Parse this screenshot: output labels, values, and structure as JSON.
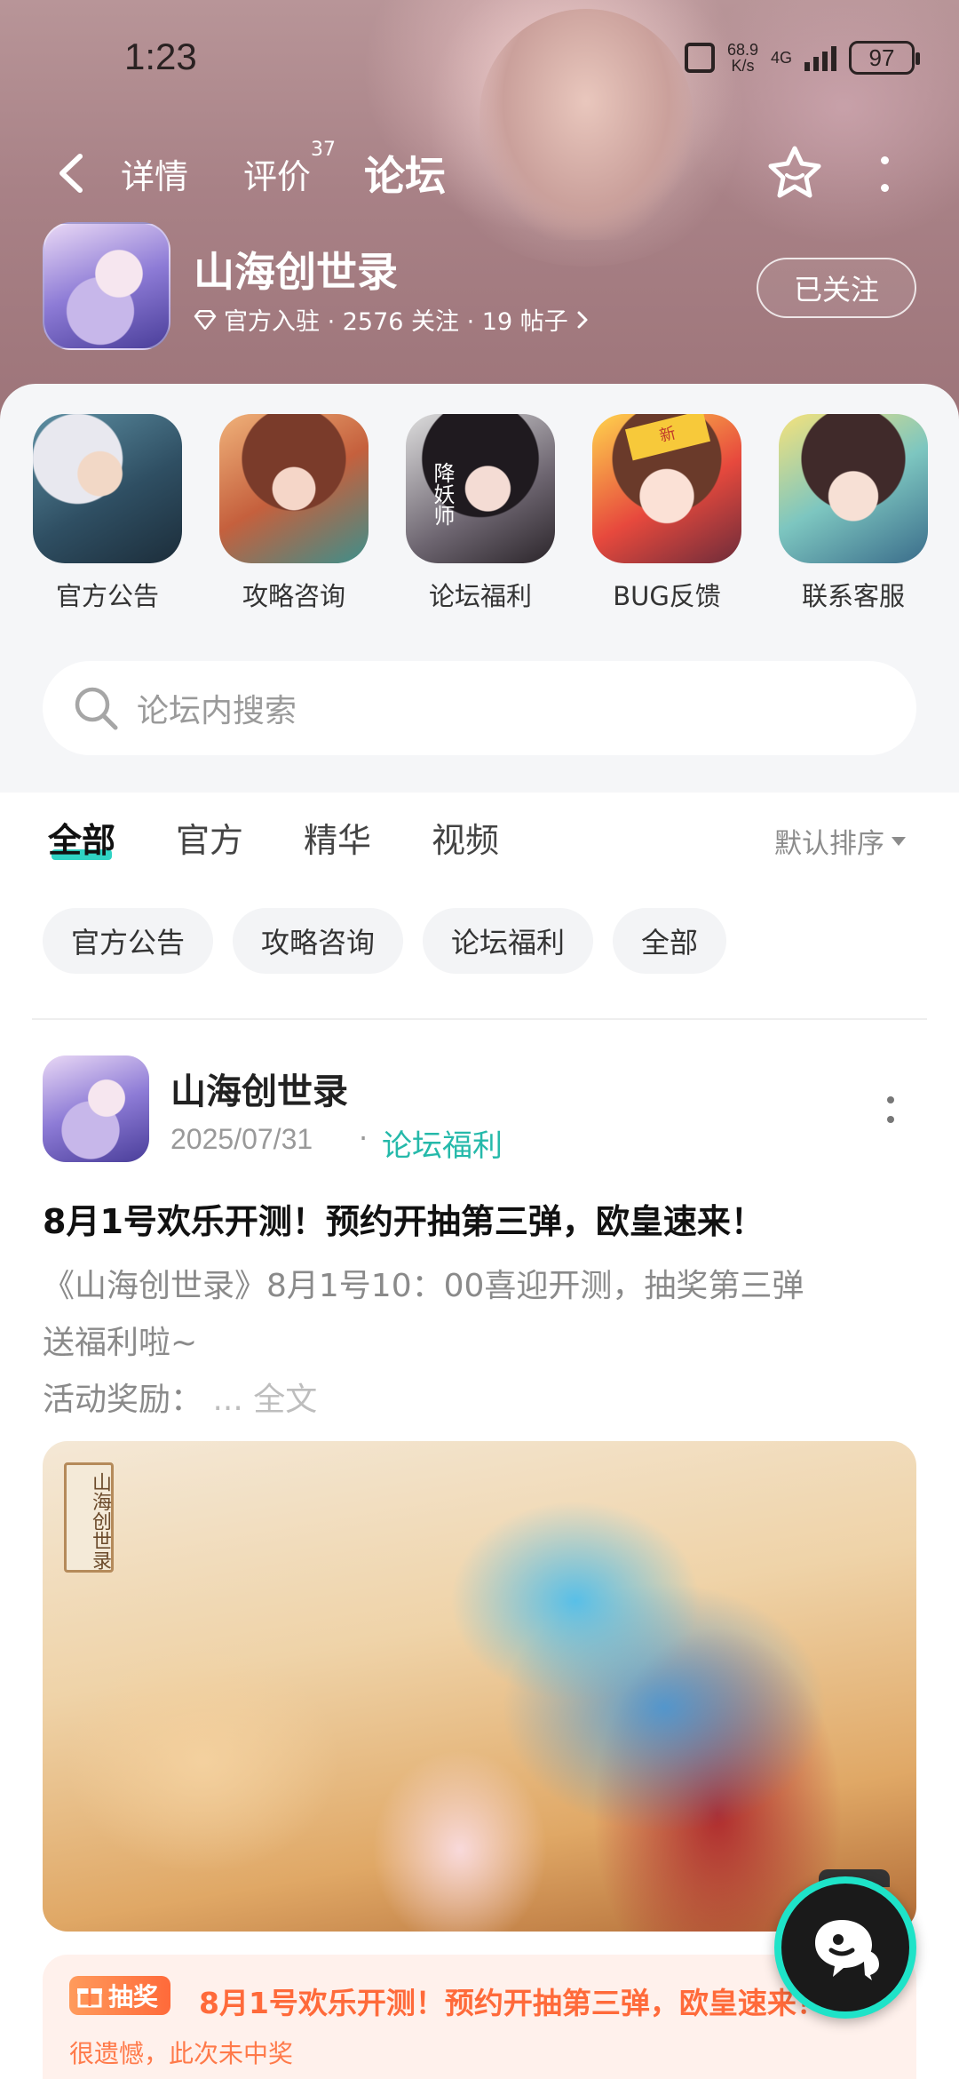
{
  "status_bar": {
    "time": "1:23",
    "net_speed_value": "68.9",
    "net_speed_unit": "K/s",
    "network": "4G",
    "battery": "97"
  },
  "top_nav": {
    "tabs": [
      {
        "label": "详情"
      },
      {
        "label": "评价",
        "badge": "37"
      },
      {
        "label": "论坛",
        "active": true
      }
    ],
    "accent_color": "#2fd3c4"
  },
  "app": {
    "name": "山海创世录",
    "meta": "官方入驻 · 2576 关注 · 19 帖子",
    "follow_label": "已关注"
  },
  "shortcuts": [
    {
      "label": "官方公告"
    },
    {
      "label": "攻略咨询"
    },
    {
      "label": "论坛福利",
      "thumb_text": "降妖师"
    },
    {
      "label": "BUG反馈",
      "thumb_text": "新"
    },
    {
      "label": "联系客服"
    }
  ],
  "search": {
    "placeholder": "论坛内搜索"
  },
  "filter_tabs": [
    {
      "label": "全部",
      "active": true
    },
    {
      "label": "官方"
    },
    {
      "label": "精华"
    },
    {
      "label": "视频"
    }
  ],
  "sort_label": "默认排序",
  "chips": [
    "官方公告",
    "攻略咨询",
    "论坛福利",
    "全部"
  ],
  "post": {
    "author": "山海创世录",
    "date": "2025/07/31",
    "separator": "·",
    "category": "论坛福利",
    "title": "8月1号欢乐开测！预约开抽第三弹，欧皇速来！",
    "body_line1": "《山海创世录》8月1号10：00喜迎开测，抽奖第三弹",
    "body_line2": "送福利啦~",
    "body_line3": "活动奖励：",
    "more_label": "... 全文",
    "image_seal": "山海创世录"
  },
  "lottery": {
    "badge": "抽奖",
    "title": "8月1号欢乐开测！预约开抽第三弹，欧皇速来！",
    "subtitle": "很遗憾，此次未中奖"
  }
}
